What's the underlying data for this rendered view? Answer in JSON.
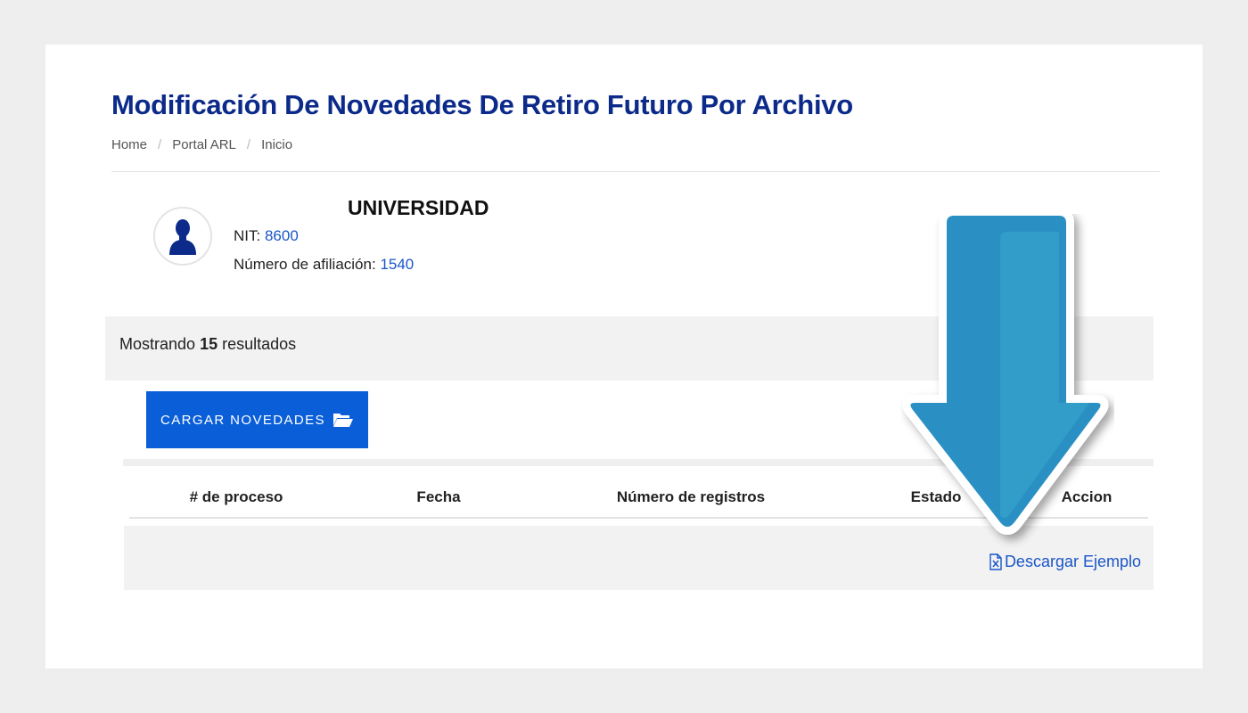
{
  "header": {
    "title": "Modificación De Novedades De Retiro Futuro Por Archivo",
    "breadcrumb": [
      "Home",
      "Portal ARL",
      "Inicio"
    ]
  },
  "company": {
    "name": "UNIVERSIDAD",
    "nit_label": "NIT:",
    "nit_value": "8600",
    "affiliation_label": "Número de afiliación:",
    "affiliation_value": "1540"
  },
  "results": {
    "prefix": "Mostrando",
    "count": "15",
    "suffix": "resultados"
  },
  "upload_button": {
    "label": "CARGAR NOVEDADES",
    "icon": "folder-open-icon"
  },
  "table": {
    "columns": [
      "# de proceso",
      "Fecha",
      "Número de registros",
      "Estado",
      "Accion"
    ],
    "download_label": "Descargar Ejemplo",
    "download_icon": "excel-file-icon"
  },
  "colors": {
    "title": "#0b2a8a",
    "link": "#1a56c9",
    "button": "#0a5fd8",
    "arrow": "#2a92c4"
  }
}
